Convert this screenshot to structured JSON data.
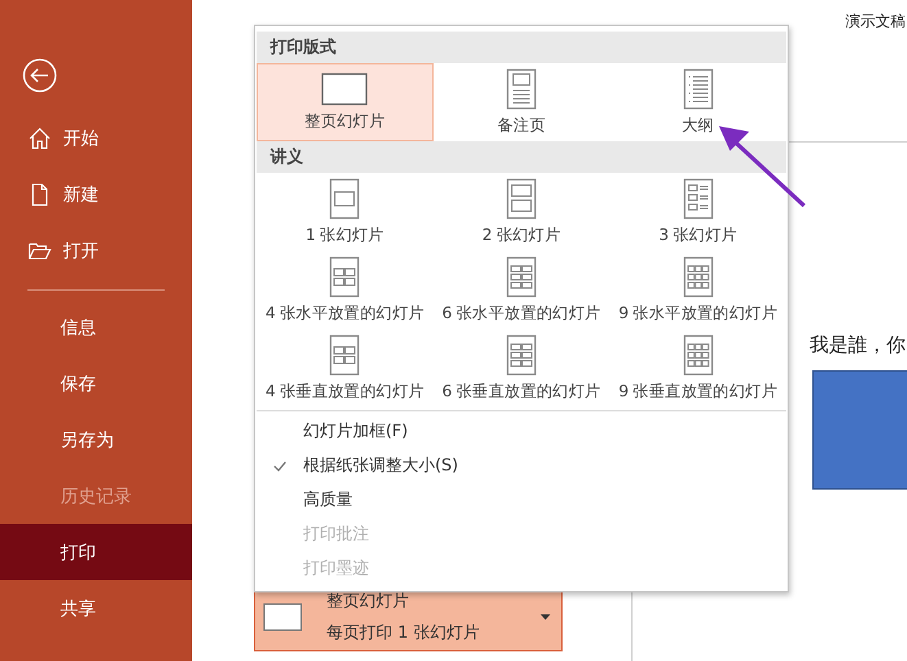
{
  "sidebar": {
    "top_items": [
      {
        "label": "开始",
        "kind": "home",
        "selected": false,
        "disabled": false
      },
      {
        "label": "新建",
        "kind": "new",
        "selected": false,
        "disabled": false
      },
      {
        "label": "打开",
        "kind": "open",
        "selected": false,
        "disabled": false
      }
    ],
    "items": [
      {
        "label": "信息",
        "selected": false,
        "disabled": false
      },
      {
        "label": "保存",
        "selected": false,
        "disabled": false
      },
      {
        "label": "另存为",
        "selected": false,
        "disabled": false
      },
      {
        "label": "历史记录",
        "selected": false,
        "disabled": true
      },
      {
        "label": "打印",
        "selected": true,
        "disabled": false
      },
      {
        "label": "共享",
        "selected": false,
        "disabled": false
      }
    ]
  },
  "document_title": "演示文稿",
  "slide_preview": {
    "text": "我是誰，你"
  },
  "layout_menu": {
    "sections": [
      {
        "title": "打印版式",
        "items": [
          {
            "label": "整页幻灯片",
            "kind": "full",
            "selected": true
          },
          {
            "label": "备注页",
            "kind": "notes",
            "selected": false
          },
          {
            "label": "大纲",
            "kind": "outline",
            "selected": false
          }
        ]
      },
      {
        "title": "讲义",
        "items": [
          {
            "label": "1 张幻灯片",
            "kind": "handout1",
            "selected": false
          },
          {
            "label": "2 张幻灯片",
            "kind": "handout2",
            "selected": false
          },
          {
            "label": "3 张幻灯片",
            "kind": "handout3",
            "selected": false
          },
          {
            "label": "4 张水平放置的幻灯片",
            "kind": "handout4",
            "selected": false
          },
          {
            "label": "6 张水平放置的幻灯片",
            "kind": "handout6",
            "selected": false
          },
          {
            "label": "9 张水平放置的幻灯片",
            "kind": "handout9",
            "selected": false
          },
          {
            "label": "4 张垂直放置的幻灯片",
            "kind": "handout4",
            "selected": false
          },
          {
            "label": "6 张垂直放置的幻灯片",
            "kind": "handout6",
            "selected": false
          },
          {
            "label": "9 张垂直放置的幻灯片",
            "kind": "handout9",
            "selected": false
          }
        ]
      }
    ],
    "options": [
      {
        "label": "幻灯片加框(F)",
        "checked": false,
        "disabled": false
      },
      {
        "label": "根据纸张调整大小(S)",
        "checked": true,
        "disabled": false
      },
      {
        "label": "高质量",
        "checked": false,
        "disabled": false
      },
      {
        "label": "打印批注",
        "checked": false,
        "disabled": true
      },
      {
        "label": "打印墨迹",
        "checked": false,
        "disabled": true
      }
    ]
  },
  "layout_dropdown": {
    "title": "整页幻灯片",
    "subtitle": "每页打印 1 张幻灯片"
  }
}
